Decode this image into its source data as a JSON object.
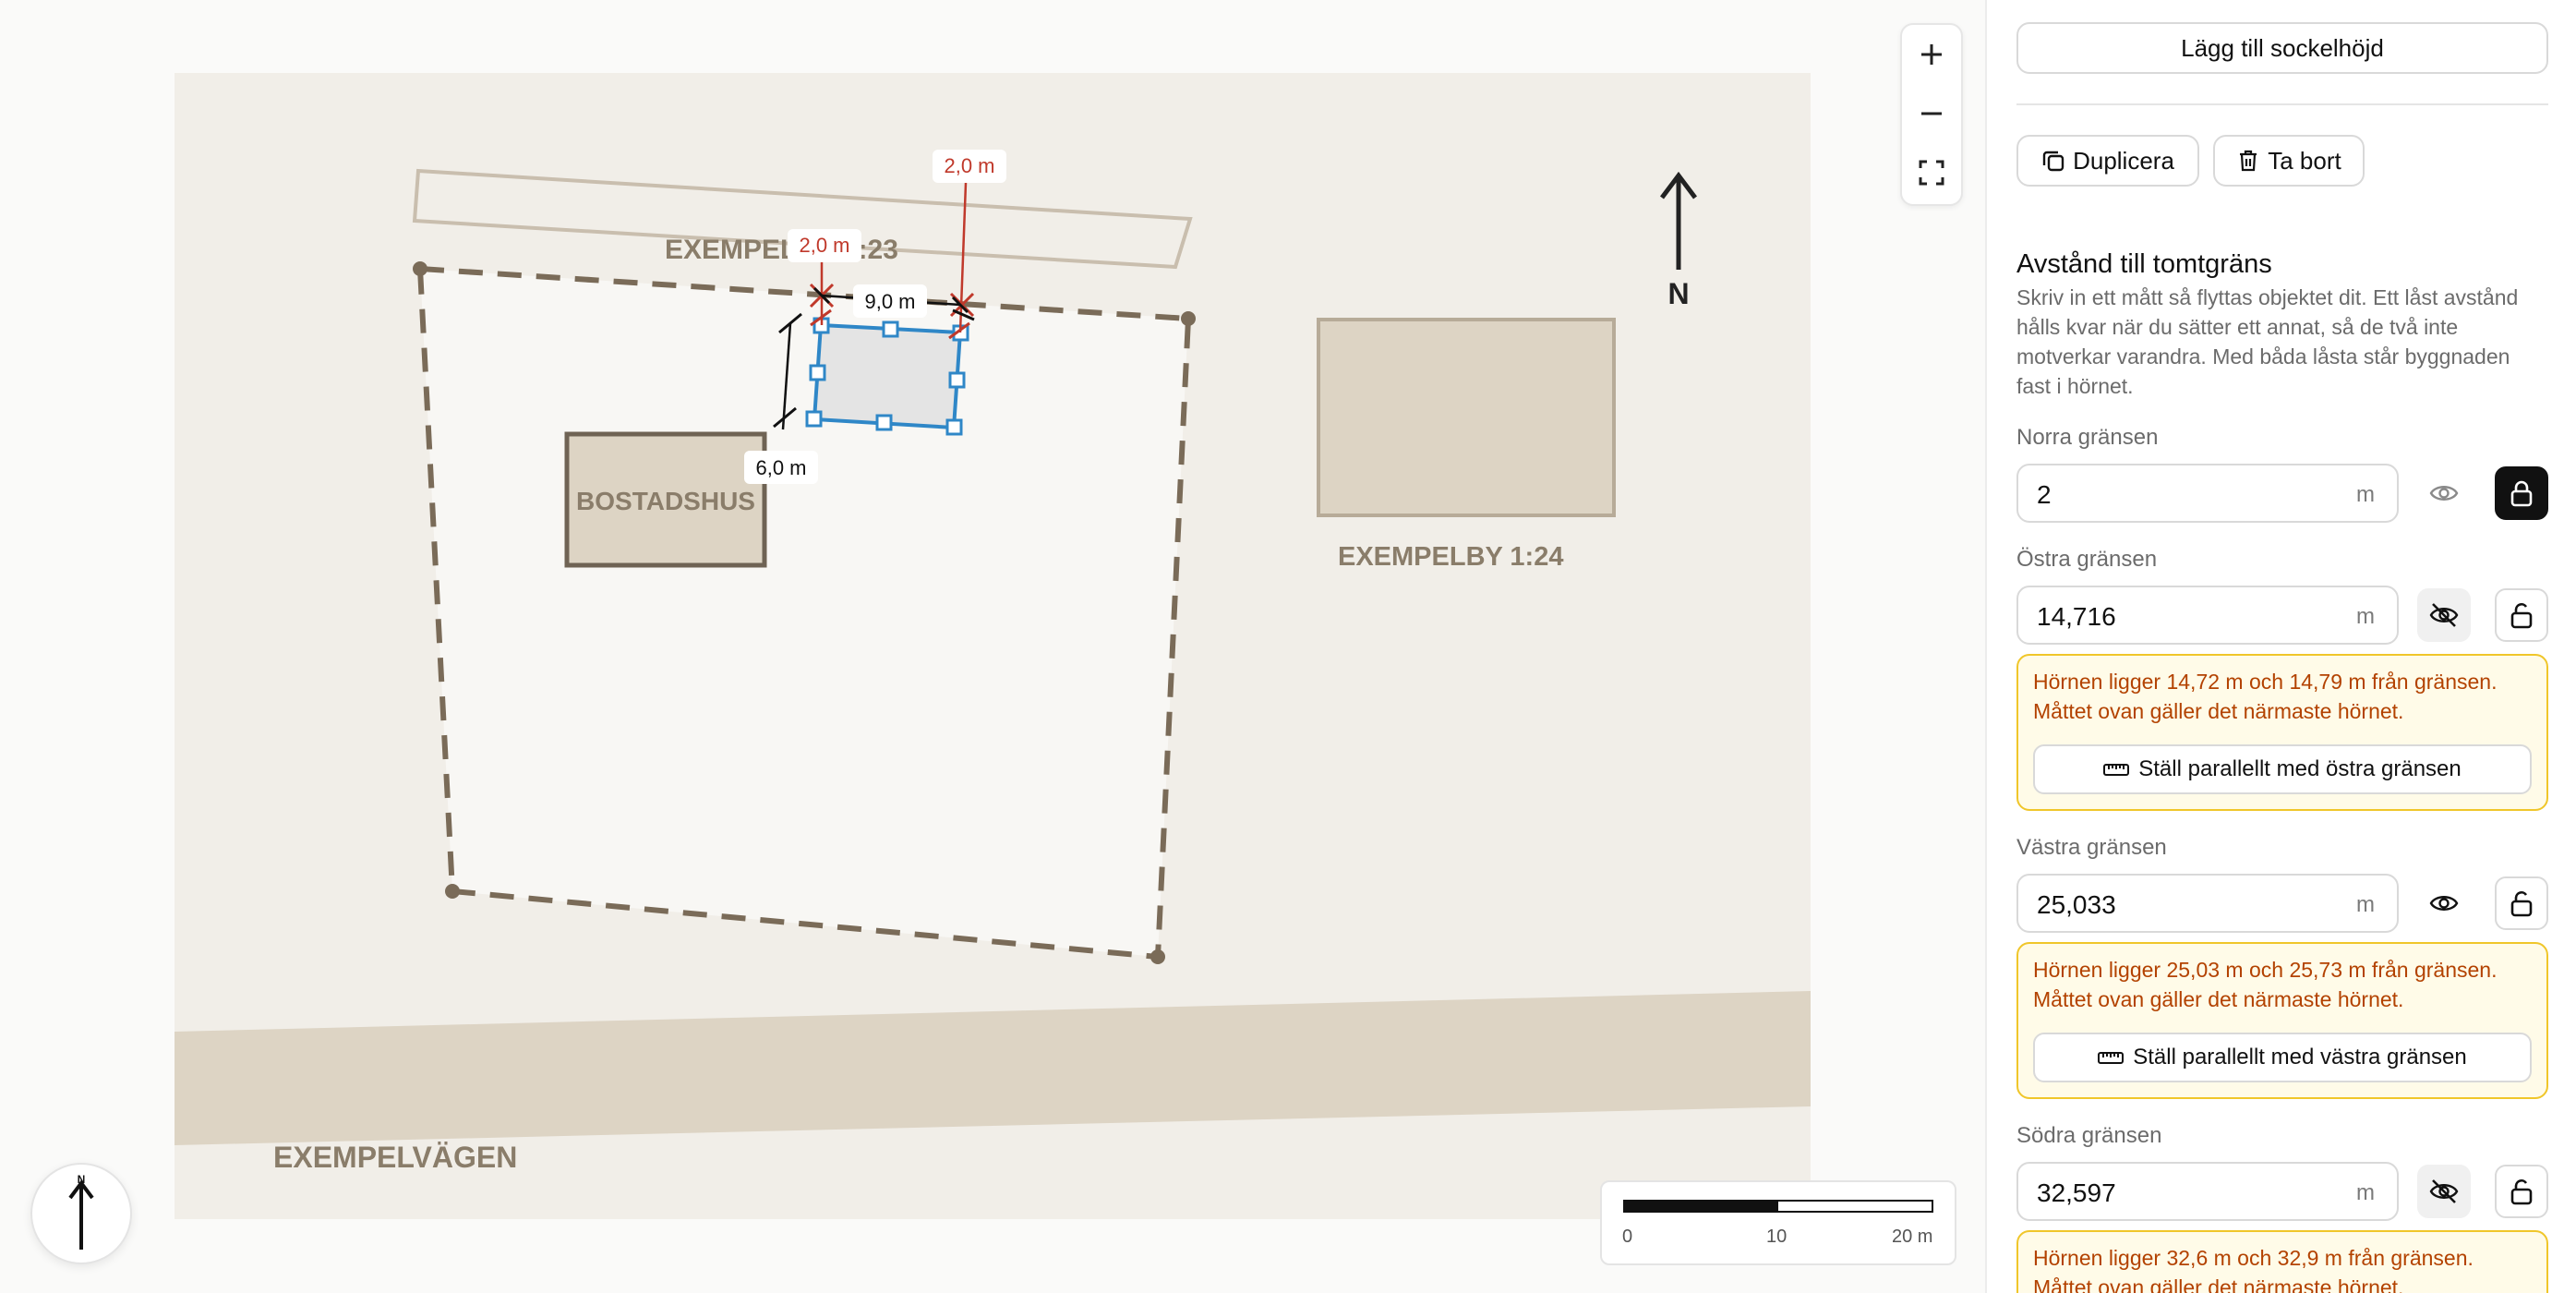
{
  "map": {
    "labels": {
      "plot_name": "EXEMPELBY 1:23",
      "neighbor_plot": "EXEMPELBY 1:24",
      "road": "EXEMPELVÄGEN",
      "house": "BOSTADSHUS",
      "north": "N"
    },
    "dimensions": {
      "north_a": "2,0 m",
      "north_b": "2,0 m",
      "width": "9,0 m",
      "west": "6,0 m"
    },
    "scale": {
      "ticks": [
        "0",
        "10",
        "20 m"
      ]
    },
    "controls": {
      "zoom_in": "+",
      "zoom_out": "−"
    }
  },
  "panel": {
    "add_plinth_label": "Lägg till sockelhöjd",
    "duplicate_label": "Duplicera",
    "delete_label": "Ta bort",
    "section_title": "Avstånd till tomtgräns",
    "section_desc": "Skriv in ett mått så flyttas objektet dit. Ett låst avstånd hålls kvar när du sätter ett annat, så de två inte motverkar varandra. Med båda låsta står byggnaden fast i hörnet.",
    "unit": "m",
    "north": {
      "label": "Norra gränsen",
      "value": "2",
      "visible": true,
      "locked": true
    },
    "east": {
      "label": "Östra gränsen",
      "value": "14,716",
      "visible": false,
      "locked": false,
      "warning": "Hörnen ligger 14,72 m och 14,79 m från gränsen. Måttet ovan gäller det närmaste hörnet.",
      "parallel_label": "Ställ parallellt med östra gränsen"
    },
    "west": {
      "label": "Västra gränsen",
      "value": "25,033",
      "visible": true,
      "locked": false,
      "warning": "Hörnen ligger 25,03 m och 25,73 m från gränsen. Måttet ovan gäller det närmaste hörnet.",
      "parallel_label": "Ställ parallellt med västra gränsen"
    },
    "south": {
      "label": "Södra gränsen",
      "value": "32,597",
      "visible": false,
      "locked": false,
      "warning": "Hörnen ligger 32,6 m och 32,9 m från gränsen. Måttet ovan gäller det närmaste hörnet."
    }
  },
  "colors": {
    "plot_bg": "#f1eee8",
    "plot_interior": "#f8f7f4",
    "road": "#ddd4c4",
    "building_fill": "#ddd4c4",
    "boundary": "#7a6b58",
    "selection": "#2f87c7",
    "dimension_red": "#c0392b",
    "warning_text": "#b34200",
    "warning_border": "#f0c62a"
  },
  "icons": [
    "plus-icon",
    "minus-icon",
    "fullscreen-icon",
    "north-arrow-icon",
    "copy-icon",
    "trash-icon",
    "eye-icon",
    "eye-off-icon",
    "lock-icon",
    "unlock-icon",
    "ruler-icon"
  ]
}
